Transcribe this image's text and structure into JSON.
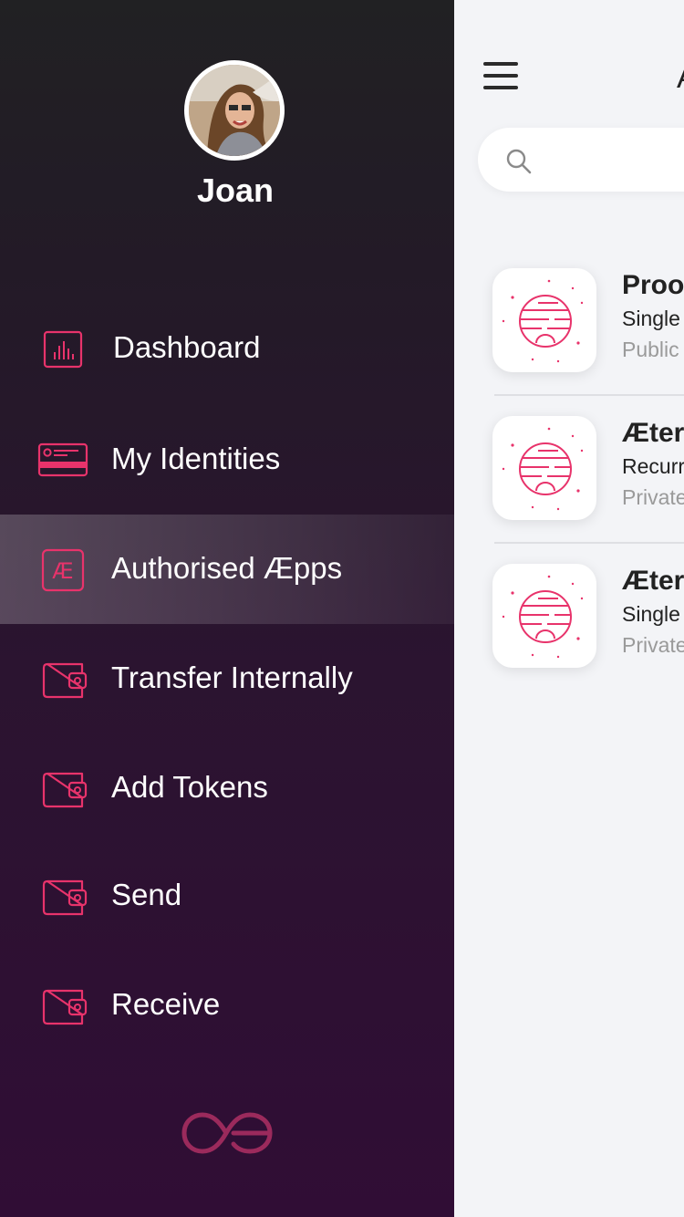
{
  "drawer": {
    "user": {
      "name": "Joan"
    },
    "menu": [
      {
        "label": "Dashboard",
        "icon": "bar-chart-icon"
      },
      {
        "label": "My Identities",
        "icon": "id-card-icon"
      },
      {
        "label": "Authorised Æpps",
        "icon": "ae-badge-icon",
        "active": true
      },
      {
        "label": "Transfer Internally",
        "icon": "wallet-icon"
      },
      {
        "label": "Add Tokens",
        "icon": "wallet-icon"
      },
      {
        "label": "Send",
        "icon": "wallet-icon"
      },
      {
        "label": "Receive",
        "icon": "wallet-icon"
      }
    ],
    "logo": "aeternity-logo"
  },
  "main": {
    "title": "A",
    "search": {
      "placeholder": "",
      "value": ""
    },
    "apps": [
      {
        "name": "Proo",
        "type": "Single",
        "visibility": "Public"
      },
      {
        "name": "Æter",
        "type": "Recurr",
        "visibility": "Private"
      },
      {
        "name": "Æter",
        "type": "Single",
        "visibility": "Private"
      }
    ]
  },
  "colors": {
    "accent": "#e8336b",
    "drawer_top": "#212123",
    "drawer_bottom": "#300d35",
    "background": "#f3f4f7",
    "muted_text": "#9a9a9a"
  }
}
